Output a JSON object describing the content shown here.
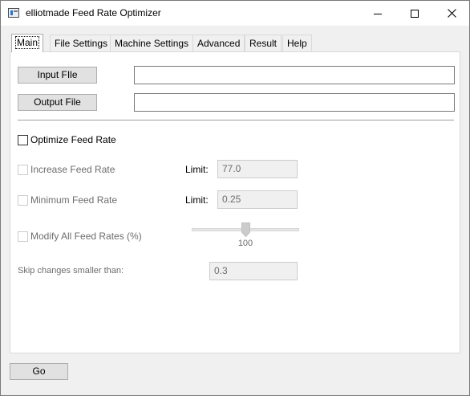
{
  "window": {
    "title": "elliotmade Feed Rate Optimizer",
    "controls": {
      "minimize": "minimize-icon",
      "maximize": "maximize-icon",
      "close": "close-icon"
    }
  },
  "tabs": [
    {
      "label": "Main",
      "active": true
    },
    {
      "label": "File Settings",
      "active": false
    },
    {
      "label": "Machine Settings",
      "active": false
    },
    {
      "label": "Advanced",
      "active": false
    },
    {
      "label": "Result",
      "active": false
    },
    {
      "label": "Help",
      "active": false
    }
  ],
  "main": {
    "input_file": {
      "button_label": "Input FIle",
      "value": ""
    },
    "output_file": {
      "button_label": "Output File",
      "value": ""
    },
    "optimize": {
      "label": "Optimize Feed Rate",
      "checked": false
    },
    "increase": {
      "label": "Increase Feed Rate",
      "checked": false,
      "limit_label": "Limit:",
      "limit_value": "77.0"
    },
    "minimum": {
      "label": "Minimum Feed Rate",
      "checked": false,
      "limit_label": "Limit:",
      "limit_value": "0.25"
    },
    "modify_all": {
      "label": "Modify All Feed Rates (%)",
      "checked": false,
      "slider_value": "100",
      "slider_fraction": 0.5
    },
    "skip": {
      "label": "Skip changes smaller than:",
      "value": "0.3"
    }
  },
  "footer": {
    "go_label": "Go"
  },
  "colors": {
    "titlebar_bg": "#ffffff",
    "window_bg": "#f0f0f0",
    "panel_bg": "#ffffff",
    "button_bg": "#e1e1e1",
    "disabled_text": "#6d6d6d"
  }
}
